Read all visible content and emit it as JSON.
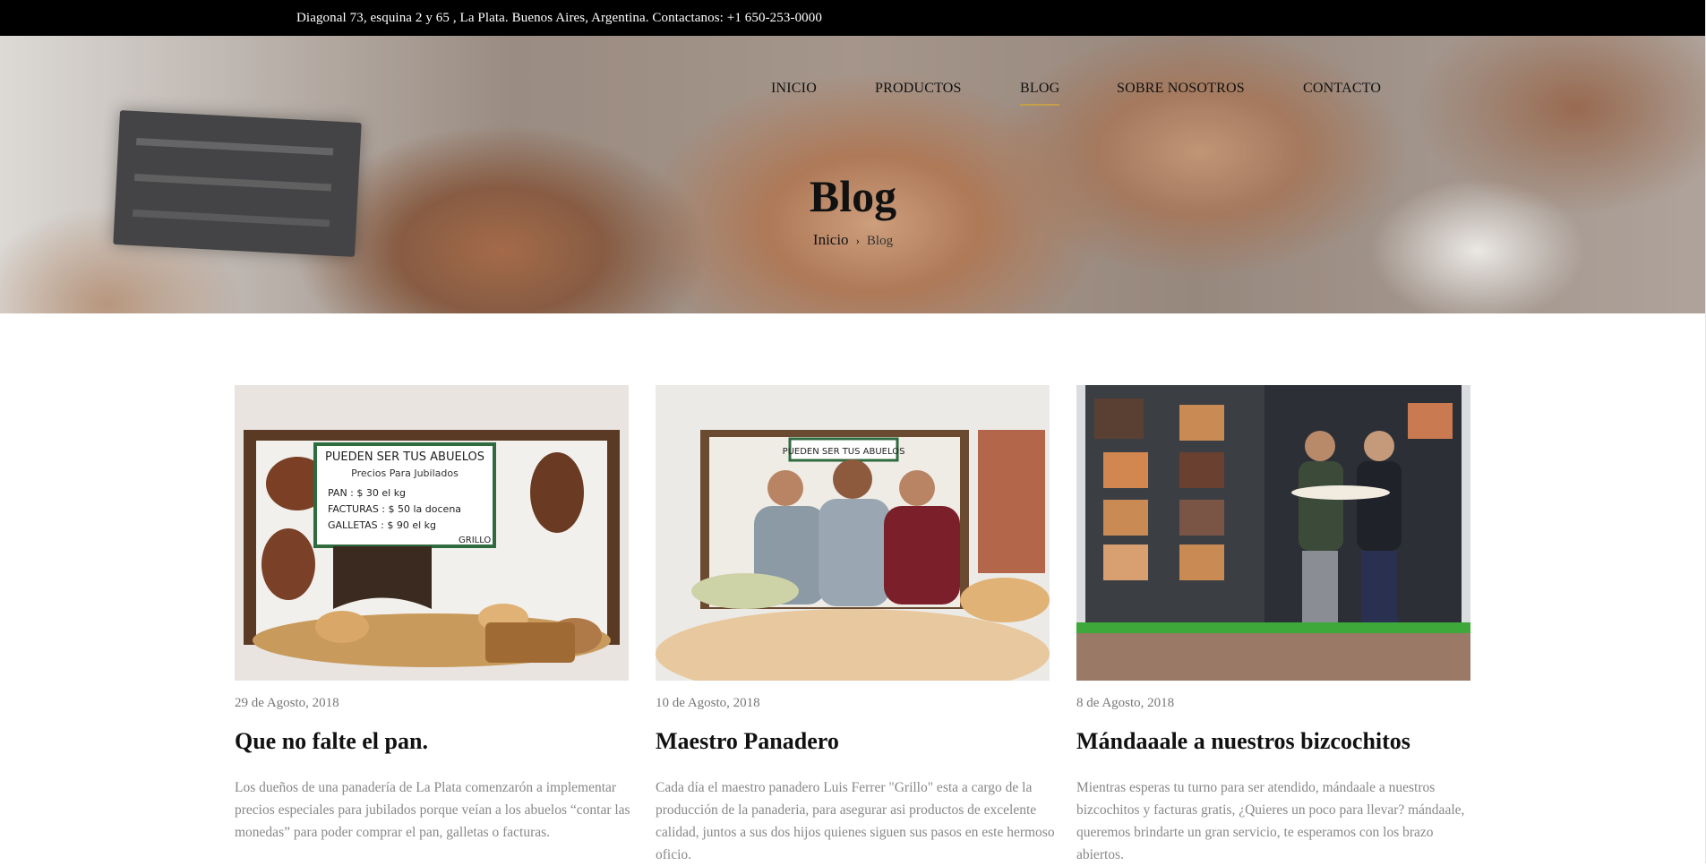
{
  "topbar": {
    "text": "Diagonal 73, esquina 2 y 65 , La Plata. Buenos Aires, Argentina. Contactanos: +1 650-253-0000"
  },
  "nav": {
    "items": [
      {
        "label": "INICIO"
      },
      {
        "label": "PRODUCTOS"
      },
      {
        "label": "BLOG",
        "active": true
      },
      {
        "label": "SOBRE NOSOTROS"
      },
      {
        "label": "CONTACTO"
      }
    ]
  },
  "hero": {
    "title": "Blog",
    "breadcrumb": {
      "home": "Inicio",
      "separator": "›",
      "current": "Blog"
    }
  },
  "posts": [
    {
      "date": "29 de Agosto, 2018",
      "title": "Que no falte el pan.",
      "excerpt": "Los dueños de una panadería de La Plata comenzarón a implementar precios especiales para jubilados porque veían a los abuelos “contar las monedas” para poder comprar el pan, galletas o facturas.",
      "image_sign": [
        "PUEDEN SER TUS ABUELOS",
        "Precios Para Jubilados",
        "PAN : $ 30 el kg",
        "FACTURAS : $ 50 la docena",
        "GALLETAS : $ 90 el kg",
        "GRILLO"
      ]
    },
    {
      "date": "10 de Agosto, 2018",
      "title": "Maestro Panadero",
      "excerpt": "Cada día el maestro panadero Luis Ferrer \"Grillo\" esta a cargo de la producción de la panaderia, para asegurar asi productos de excelente calidad, juntos a sus dos hijos quienes siguen sus pasos en este hermoso oficio.",
      "image_sign": [
        "PUEDEN SER TUS ABUELOS"
      ]
    },
    {
      "date": "8 de Agosto, 2018",
      "title": "Mándaaale a nuestros bizcochitos",
      "excerpt": "Mientras esperas tu turno para ser atendido, mándaale a nuestros bizcochitos y facturas gratis, ¿Quieres un poco para llevar? mándaale, queremos brindarte un gran servicio, te esperamos con los brazo abiertos."
    }
  ],
  "colors": {
    "accent": "#c4a04a",
    "topbar": "#000000",
    "text": "#111111",
    "muted": "#888888"
  }
}
